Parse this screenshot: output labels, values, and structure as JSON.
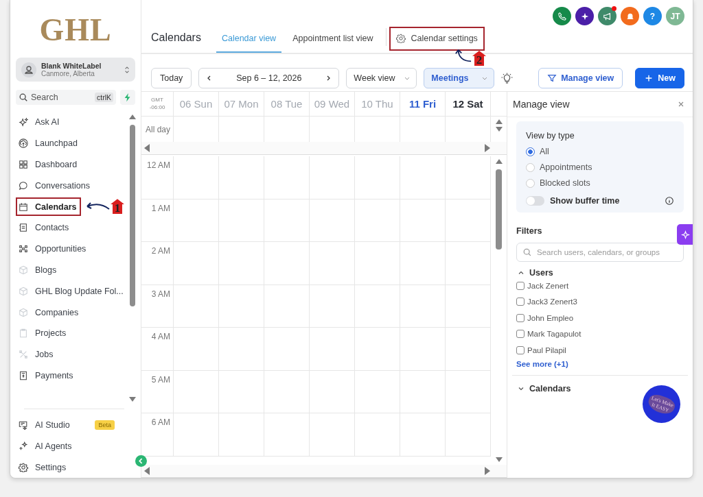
{
  "logo": "GHL",
  "account": {
    "name": "Blank WhiteLabel",
    "location": "Canmore, Alberta"
  },
  "search": {
    "label": "Search",
    "shortcut": "ctrlK"
  },
  "nav": [
    {
      "label": "Ask AI",
      "selected": false
    },
    {
      "label": "Launchpad",
      "selected": false
    },
    {
      "label": "Dashboard",
      "selected": false
    },
    {
      "label": "Conversations",
      "selected": false
    },
    {
      "label": "Calendars",
      "selected": true,
      "callout": "1"
    },
    {
      "label": "Contacts",
      "selected": false
    },
    {
      "label": "Opportunities",
      "selected": false
    },
    {
      "label": "Blogs",
      "selected": false
    },
    {
      "label": "GHL Blog Update Fol...",
      "selected": false
    },
    {
      "label": "Companies",
      "selected": false
    },
    {
      "label": "Projects",
      "selected": false
    },
    {
      "label": "Jobs",
      "selected": false
    },
    {
      "label": "Payments",
      "selected": false
    }
  ],
  "nav_bottom": [
    {
      "label": "AI Studio",
      "badge": "Beta"
    },
    {
      "label": "AI Agents"
    },
    {
      "label": "Settings"
    }
  ],
  "header": {
    "title": "Calendars",
    "tabs": [
      {
        "label": "Calendar view",
        "selected": true
      },
      {
        "label": "Appointment list view",
        "selected": false
      }
    ],
    "settings_link": {
      "label": "Calendar settings",
      "callout": "2"
    }
  },
  "header_actions": [
    {
      "kind": "phone",
      "unread": false
    },
    {
      "kind": "assistant",
      "unread": false
    },
    {
      "kind": "announcements",
      "unread": true
    },
    {
      "kind": "notifications",
      "unread": false
    },
    {
      "kind": "help",
      "text": "?",
      "unread": false
    },
    {
      "kind": "avatar",
      "text": "JT",
      "unread": false
    }
  ],
  "toolbar": {
    "today": "Today",
    "range": "Sep 6 – 12, 2026",
    "view": "Week view",
    "filter": "Meetings",
    "manage": "Manage view",
    "new": "New"
  },
  "calendar": {
    "timezone": [
      "GMT",
      "-06:00"
    ],
    "days": [
      {
        "label": "06 Sun",
        "past": true,
        "today": false
      },
      {
        "label": "07 Mon",
        "past": true,
        "today": false
      },
      {
        "label": "08 Tue",
        "past": true,
        "today": false
      },
      {
        "label": "09 Wed",
        "past": true,
        "today": false
      },
      {
        "label": "10 Thu",
        "past": true,
        "today": false
      },
      {
        "label": "11 Fri",
        "past": false,
        "today": true
      },
      {
        "label": "12 Sat",
        "past": false,
        "today": false
      }
    ],
    "all_day": "All day",
    "hours": [
      "12 AM",
      "1 AM",
      "2 AM",
      "3 AM",
      "4 AM",
      "5 AM",
      "6 AM"
    ]
  },
  "panel": {
    "title": "Manage view",
    "view_by": {
      "title": "View by type",
      "options": [
        {
          "label": "All",
          "selected": true
        },
        {
          "label": "Appointments",
          "selected": false
        },
        {
          "label": "Blocked slots",
          "selected": false
        }
      ],
      "toggle": {
        "label": "Show buffer time",
        "on": false
      }
    },
    "filters": {
      "title": "Filters",
      "placeholder": "Search users, calendars, or groups",
      "sections": [
        {
          "title": "Users",
          "expanded": true,
          "items": [
            {
              "name": "Jack Zenert",
              "checked": false
            },
            {
              "name": "Jack3 Zenert3",
              "checked": false
            },
            {
              "name": "John Empleo",
              "checked": false
            },
            {
              "name": "Mark Tagapulot",
              "checked": false
            },
            {
              "name": "Paul Pilapil",
              "checked": false
            }
          ],
          "more": "See more (+1)"
        },
        {
          "title": "Calendars",
          "expanded": false
        }
      ]
    }
  },
  "sticker": "Let's Make It EASY"
}
